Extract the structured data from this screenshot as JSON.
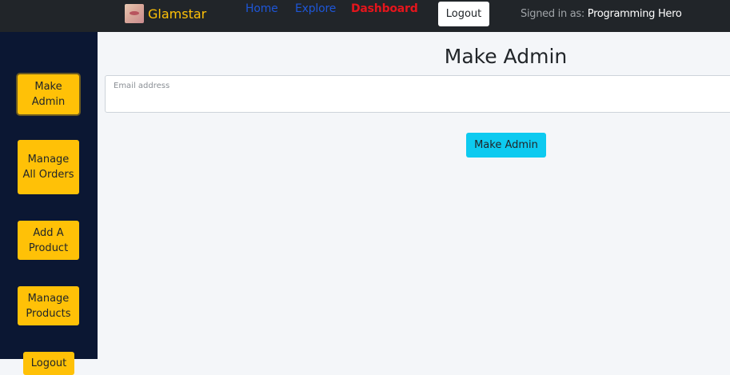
{
  "navbar": {
    "brand_name": "Glamstar",
    "links": {
      "home": "Home",
      "explore": "Explore",
      "dashboard": "Dashboard"
    },
    "logout_label": "Logout",
    "signed_in_prefix": "Signed in as:",
    "signed_in_user": "Programming Hero",
    "colors": {
      "background": "#212529",
      "brand": "#ffc107",
      "link": "#1e56d6",
      "active_link": "#e5151c"
    }
  },
  "sidebar": {
    "items": [
      {
        "label": "Make Admin",
        "active": true
      },
      {
        "label": "Manage All Orders",
        "active": false
      },
      {
        "label": "Add A Product",
        "active": false
      },
      {
        "label": "Manage Products",
        "active": false
      },
      {
        "label": "Logout",
        "active": false
      }
    ],
    "colors": {
      "background": "#0b1733",
      "button": "#ffc107"
    }
  },
  "main": {
    "title": "Make Admin",
    "email_field": {
      "label": "Email address",
      "value": "",
      "placeholder": ""
    },
    "submit_label": "Make Admin",
    "colors": {
      "submit": "#0dcaf0",
      "background": "#f4f6f9"
    }
  },
  "icons": {
    "brand_logo": "brand-logo-icon"
  }
}
